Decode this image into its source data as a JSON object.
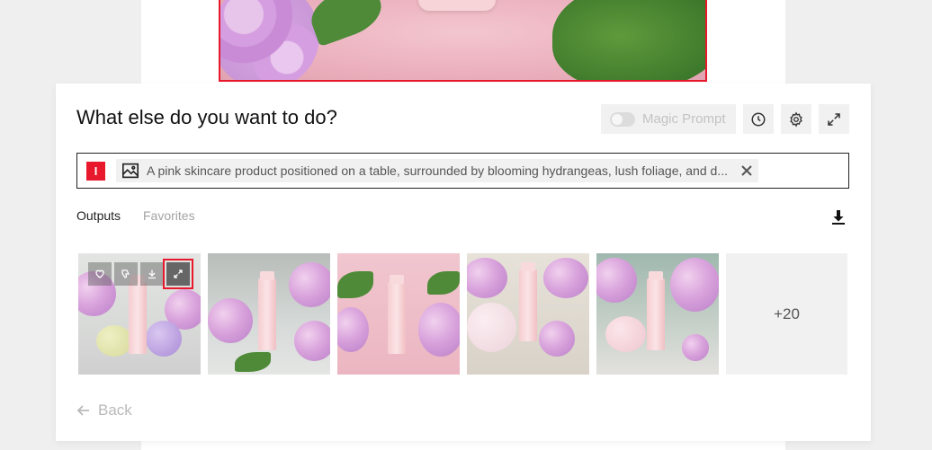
{
  "dialog": {
    "title": "What else do you want to do?",
    "magic_prompt_label": "Magic Prompt"
  },
  "prompt": {
    "badge_text": "I",
    "text": "A pink skincare product positioned on a table, surrounded by blooming hydrangeas, lush foliage, and d..."
  },
  "tabs": [
    {
      "label": "Outputs",
      "active": true
    },
    {
      "label": "Favorites",
      "active": false
    }
  ],
  "outputs": {
    "more_count_label": "+20"
  },
  "footer": {
    "back_label": "Back"
  },
  "icons": {
    "history": "clock-icon",
    "settings": "gear-icon",
    "expand": "expand-icon",
    "image": "image-icon",
    "close": "close-icon",
    "download": "download-icon",
    "like": "heart-icon",
    "dislike": "thumbs-down-icon",
    "back": "arrow-left-icon"
  },
  "colors": {
    "accent": "#e8192c"
  }
}
